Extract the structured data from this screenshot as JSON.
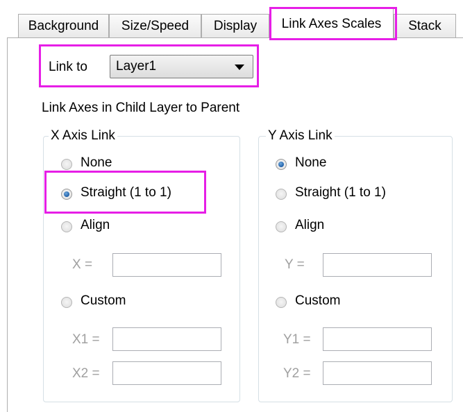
{
  "tabs": [
    {
      "label": "Background"
    },
    {
      "label": "Size/Speed"
    },
    {
      "label": "Display"
    },
    {
      "label": "Link Axes Scales"
    },
    {
      "label": "Stack"
    }
  ],
  "link_to": {
    "label": "Link to",
    "value": "Layer1"
  },
  "section_label": "Link Axes in Child Layer to Parent",
  "x_axis": {
    "title": "X Axis Link",
    "options": [
      "None",
      "Straight (1 to 1)",
      "Align",
      "Custom"
    ],
    "selected": "Straight (1 to 1)",
    "align_label": "X =",
    "custom1_label": "X1 =",
    "custom2_label": "X2 ="
  },
  "y_axis": {
    "title": "Y Axis Link",
    "options": [
      "None",
      "Straight (1 to 1)",
      "Align",
      "Custom"
    ],
    "selected": "None",
    "align_label": "Y =",
    "custom1_label": "Y1 =",
    "custom2_label": "Y2 ="
  },
  "colors": {
    "highlight": "#e61ee6",
    "radio_checked": "#1f5fa8"
  }
}
